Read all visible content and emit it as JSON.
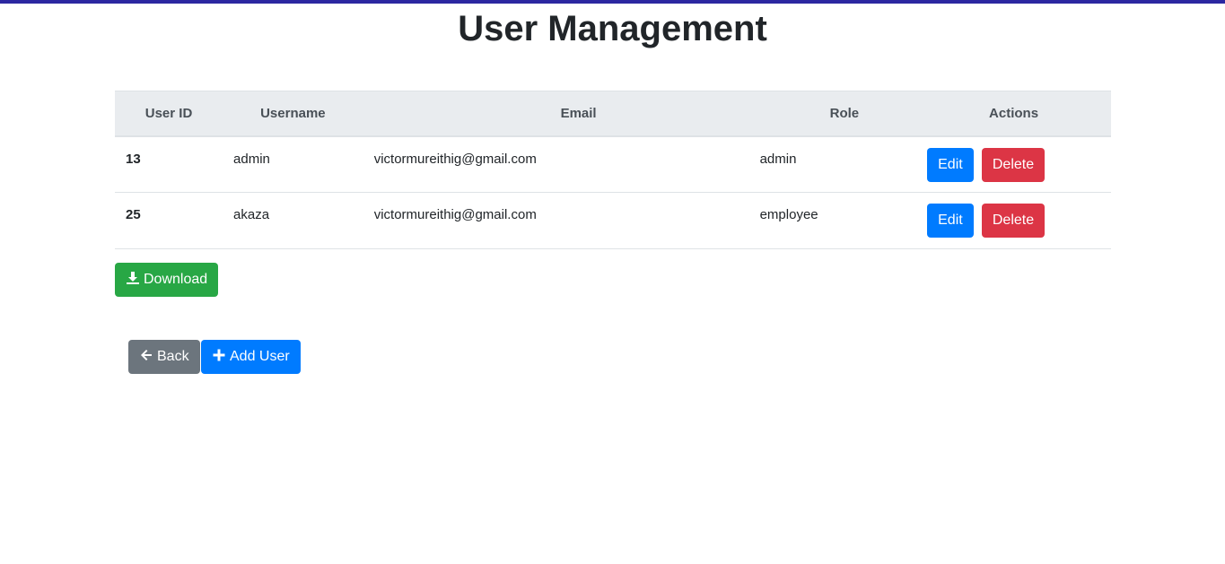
{
  "page": {
    "title": "User Management",
    "accent_color": "#2c27a1"
  },
  "table": {
    "headers": {
      "user_id": "User ID",
      "username": "Username",
      "email": "Email",
      "role": "Role",
      "actions": "Actions"
    },
    "rows": [
      {
        "user_id": "13",
        "username": "admin",
        "email": "victormureithig@gmail.com",
        "role": "admin",
        "edit_label": "Edit",
        "delete_label": "Delete"
      },
      {
        "user_id": "25",
        "username": "akaza",
        "email": "victormureithig@gmail.com",
        "role": "employee",
        "edit_label": "Edit",
        "delete_label": "Delete"
      }
    ]
  },
  "buttons": {
    "download_label": "Download",
    "download_icon": "download-icon",
    "back_label": "Back",
    "back_icon": "arrow-left-icon",
    "add_user_label": "Add User",
    "add_user_icon": "plus-icon"
  },
  "colors": {
    "primary": "#007bff",
    "danger": "#dc3545",
    "success": "#28a745",
    "secondary": "#6c757d",
    "header_bg": "#e9ecef"
  }
}
